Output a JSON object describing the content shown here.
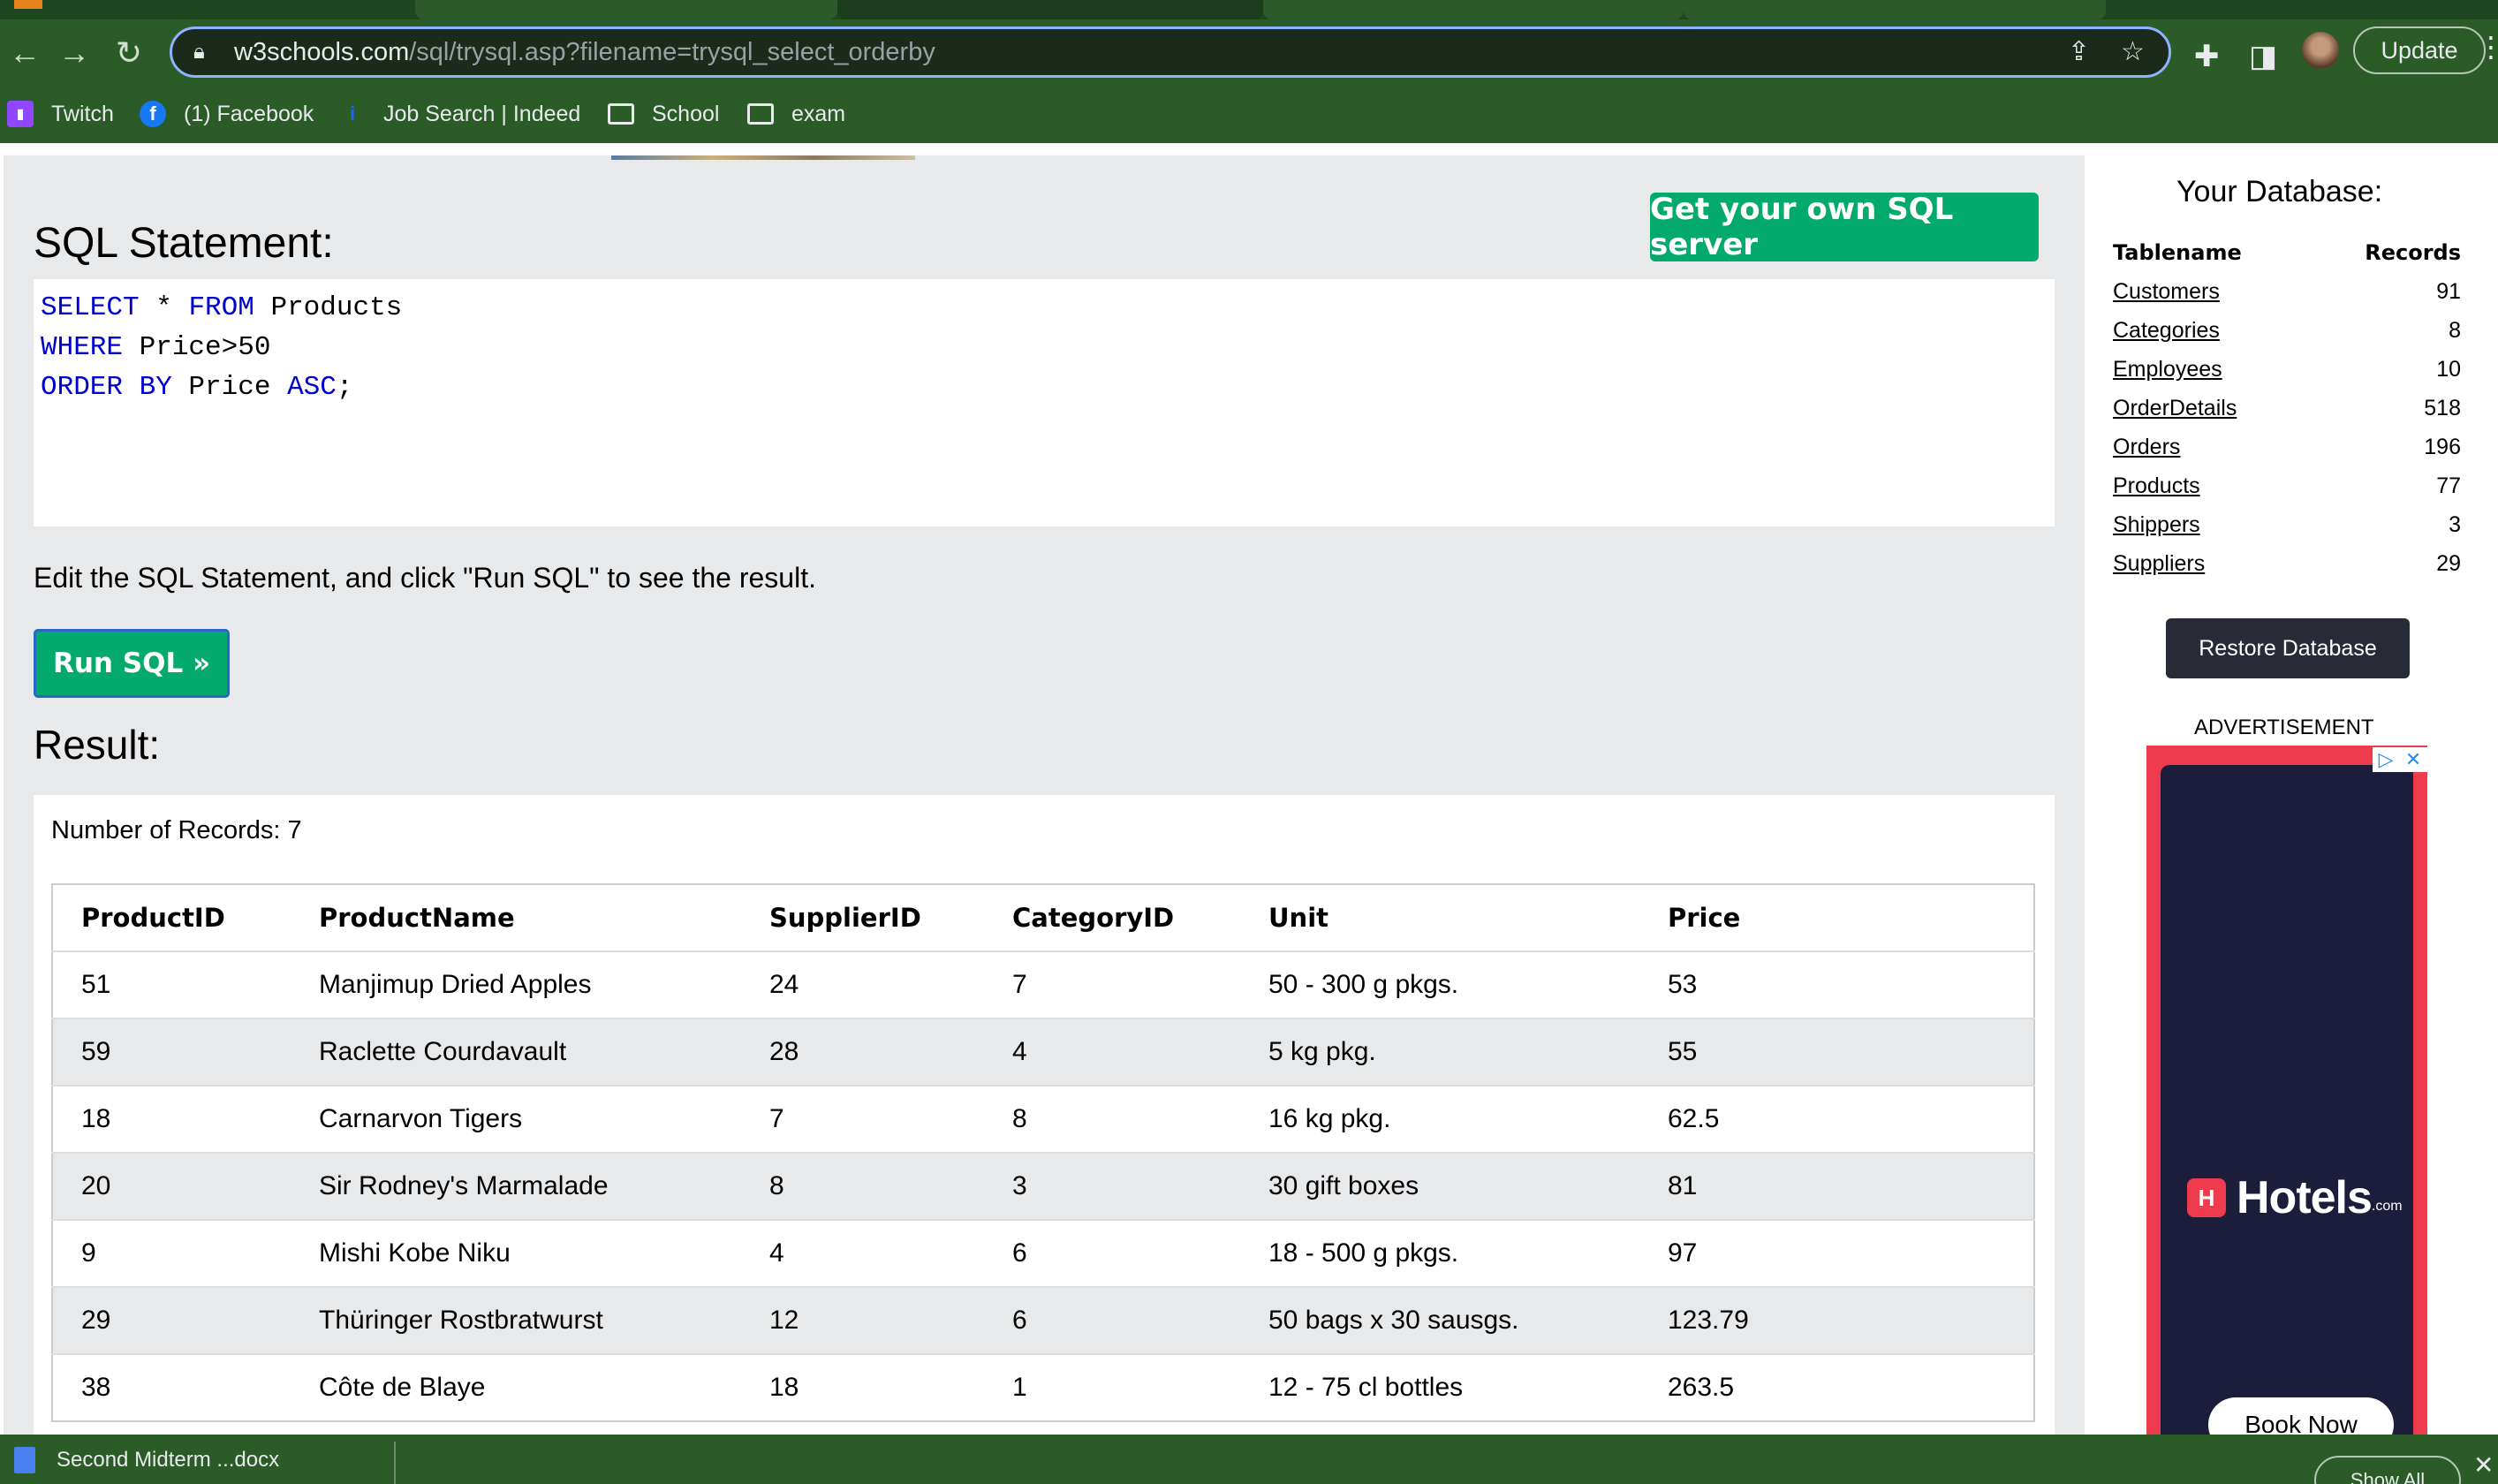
{
  "browser": {
    "url_host": "w3schools.com",
    "url_path": "/sql/trysql.asp?filename=trysql_select_orderby",
    "update_label": "Update",
    "bookmarks": [
      {
        "label": "Twitch",
        "icon": "twitch-icon"
      },
      {
        "label": "(1) Facebook",
        "icon": "facebook-icon"
      },
      {
        "label": "Job Search | Indeed",
        "icon": "indeed-icon"
      },
      {
        "label": "School",
        "icon": "folder-icon"
      },
      {
        "label": "exam",
        "icon": "folder-icon"
      }
    ]
  },
  "editor": {
    "heading": "SQL Statement:",
    "get_server_label": "Get your own SQL server",
    "code_lines": [
      [
        {
          "t": "SELECT",
          "k": true
        },
        {
          "t": " * ",
          "k": false
        },
        {
          "t": "FROM",
          "k": true
        },
        {
          "t": " Products",
          "k": false
        }
      ],
      [
        {
          "t": "WHERE",
          "k": true
        },
        {
          "t": " Price>50",
          "k": false
        }
      ],
      [
        {
          "t": "ORDER BY",
          "k": true
        },
        {
          "t": " Price ",
          "k": false
        },
        {
          "t": "ASC",
          "k": true
        },
        {
          "t": ";",
          "k": false
        }
      ]
    ],
    "instructions": "Edit the SQL Statement, and click \"Run SQL\" to see the result.",
    "run_label": "Run SQL »"
  },
  "result": {
    "heading": "Result:",
    "record_count": "Number of Records: 7",
    "columns": [
      "ProductID",
      "ProductName",
      "SupplierID",
      "CategoryID",
      "Unit",
      "Price"
    ],
    "rows": [
      [
        "51",
        "Manjimup Dried Apples",
        "24",
        "7",
        "50 - 300 g pkgs.",
        "53"
      ],
      [
        "59",
        "Raclette Courdavault",
        "28",
        "4",
        "5 kg pkg.",
        "55"
      ],
      [
        "18",
        "Carnarvon Tigers",
        "7",
        "8",
        "16 kg pkg.",
        "62.5"
      ],
      [
        "20",
        "Sir Rodney's Marmalade",
        "8",
        "3",
        "30 gift boxes",
        "81"
      ],
      [
        "9",
        "Mishi Kobe Niku",
        "4",
        "6",
        "18 - 500 g pkgs.",
        "97"
      ],
      [
        "29",
        "Thüringer Rostbratwurst",
        "12",
        "6",
        "50 bags x 30 sausgs.",
        "123.79"
      ],
      [
        "38",
        "Côte de Blaye",
        "18",
        "1",
        "12 - 75 cl bottles",
        "263.5"
      ]
    ]
  },
  "sidebar": {
    "title": "Your Database:",
    "col_name": "Tablename",
    "col_records": "Records",
    "tables": [
      {
        "name": "Customers",
        "records": "91"
      },
      {
        "name": "Categories",
        "records": "8"
      },
      {
        "name": "Employees",
        "records": "10"
      },
      {
        "name": "OrderDetails",
        "records": "518"
      },
      {
        "name": "Orders",
        "records": "196"
      },
      {
        "name": "Products",
        "records": "77"
      },
      {
        "name": "Shippers",
        "records": "3"
      },
      {
        "name": "Suppliers",
        "records": "29"
      }
    ],
    "restore_label": "Restore Database",
    "ad_label": "ADVERTISEMENT",
    "ad_brand": "Hotels",
    "ad_brand_suffix": ".com",
    "ad_cta": "Book Now"
  },
  "downloads": {
    "item_label": "Second Midterm ...docx",
    "show_all_label": "Show All"
  },
  "colors": {
    "w3_green": "#04aa6d",
    "keyword_blue": "#0000cd",
    "chrome_green": "#2b5c28",
    "panel_gray": "#e7e9eb",
    "restore_dark": "#282a35"
  }
}
